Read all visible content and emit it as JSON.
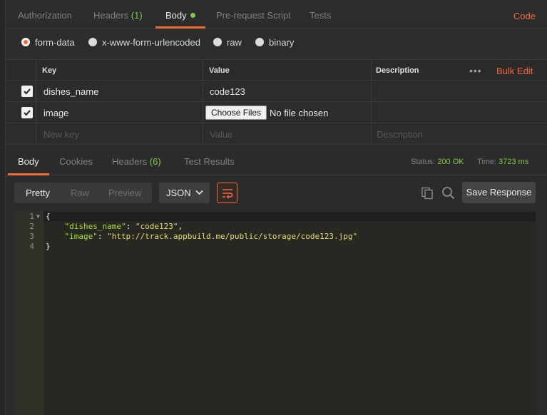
{
  "request_tabs": [
    {
      "label": "Authorization"
    },
    {
      "label": "Headers",
      "count": "(1)"
    },
    {
      "label": "Body"
    },
    {
      "label": "Pre-request Script"
    },
    {
      "label": "Tests"
    }
  ],
  "code_link": "Code",
  "body_modes": [
    {
      "label": "form-data",
      "selected": true
    },
    {
      "label": "x-www-form-urlencoded",
      "selected": false
    },
    {
      "label": "raw",
      "selected": false
    },
    {
      "label": "binary",
      "selected": false
    }
  ],
  "params_table": {
    "headers": {
      "key": "Key",
      "value": "Value",
      "description": "Description"
    },
    "bulk_edit": "Bulk Edit",
    "rows": [
      {
        "key": "dishes_name",
        "value": "code123",
        "checked": true
      },
      {
        "key": "image",
        "type": "file",
        "checked": true,
        "file_button": "Choose Files",
        "file_status": "No file chosen"
      }
    ],
    "new_row": {
      "key_placeholder": "New key",
      "value_placeholder": "Value",
      "description_placeholder": "Description"
    }
  },
  "response": {
    "tabs": [
      {
        "label": "Body"
      },
      {
        "label": "Cookies"
      },
      {
        "label": "Headers",
        "count": "(6)"
      },
      {
        "label": "Test Results"
      }
    ],
    "status_label": "Status:",
    "status_value": "200 OK",
    "time_label": "Time:",
    "time_value": "3723 ms",
    "view_modes": [
      "Pretty",
      "Raw",
      "Preview"
    ],
    "format": "JSON",
    "save_label": "Save Response",
    "line_numbers": [
      "1",
      "2",
      "3",
      "4"
    ],
    "json": {
      "open": "{",
      "dishes_key": "\"dishes_name\"",
      "dishes_value": "\"code123\"",
      "image_key": "\"image\"",
      "image_value": "\"http://track.appbuild.me/public/storage/code123.jpg\"",
      "close": "}"
    }
  },
  "colors": {
    "accent": "#f26b3a",
    "success": "#7ec74b",
    "background": "#2c2c2c",
    "editor": "#272822"
  }
}
